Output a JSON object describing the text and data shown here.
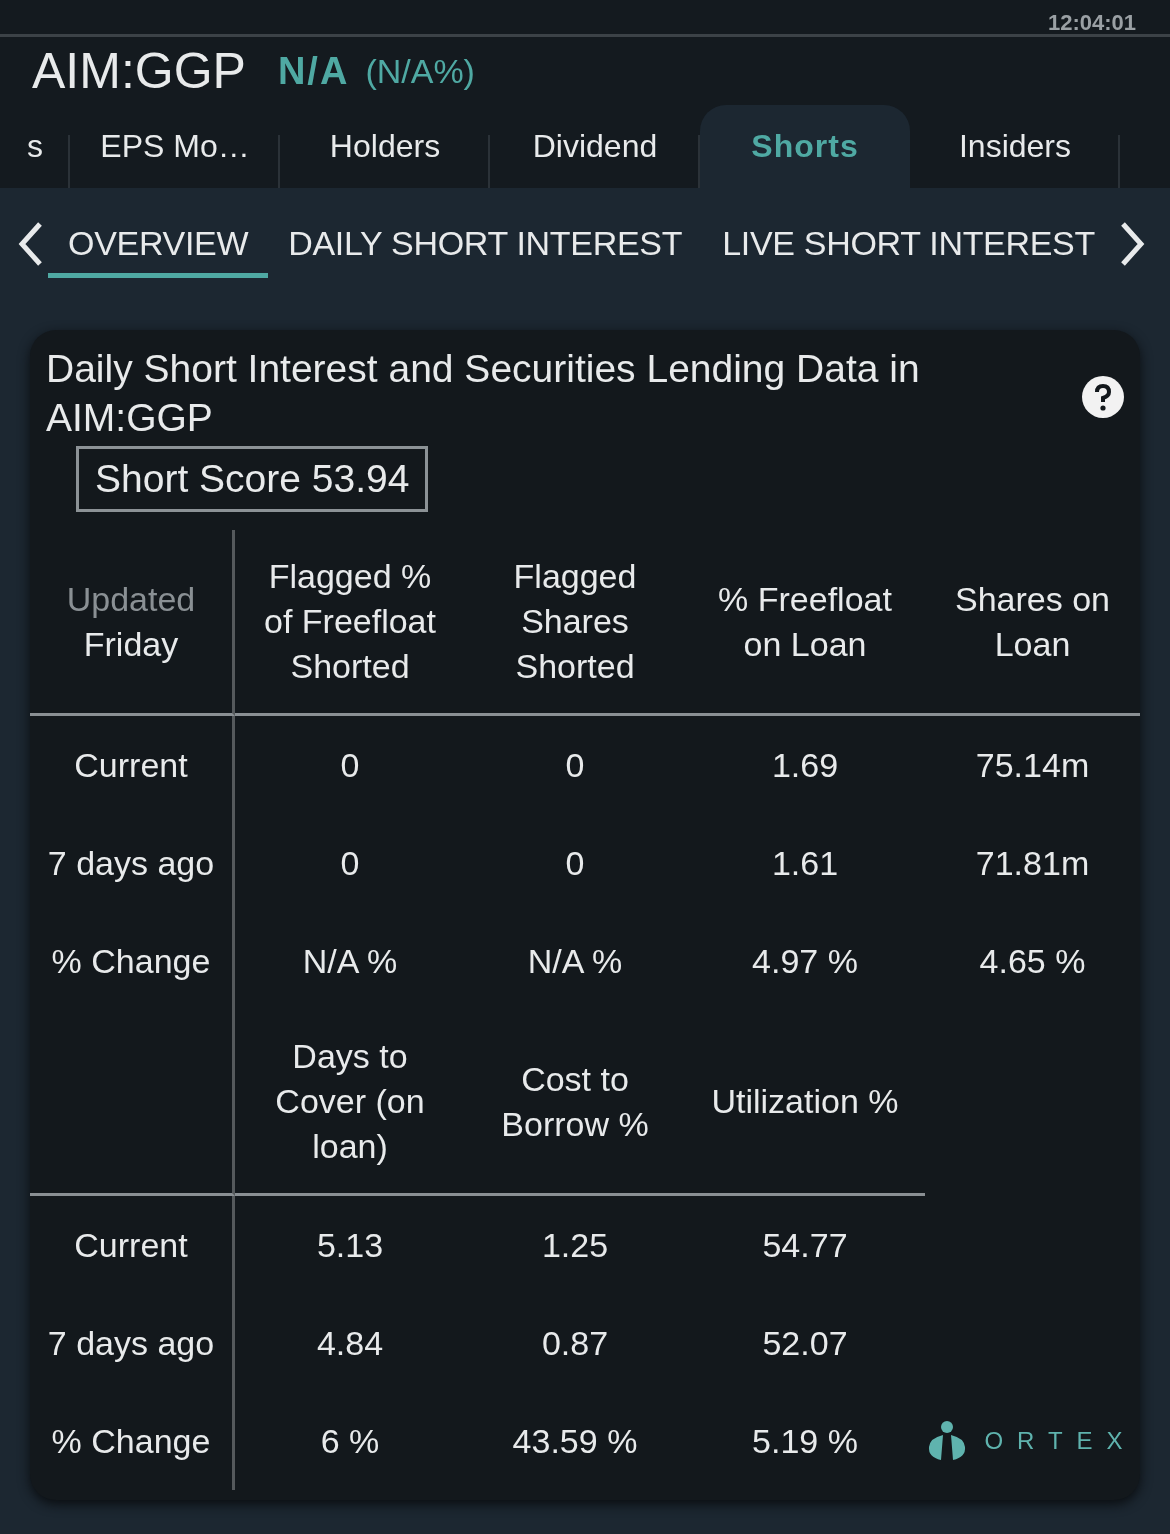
{
  "status_bar": {
    "time": "12:04:01"
  },
  "header": {
    "symbol": "AIM:GGP",
    "change": "N/A",
    "change_pct": "(N/A%)"
  },
  "tabs": [
    {
      "label": "s",
      "selected": false
    },
    {
      "label": "EPS Mo…",
      "selected": false
    },
    {
      "label": "Holders",
      "selected": false
    },
    {
      "label": "Dividend",
      "selected": false
    },
    {
      "label": "Shorts",
      "selected": true
    },
    {
      "label": "Insiders",
      "selected": false
    }
  ],
  "subtabs": [
    {
      "label": "OVERVIEW",
      "selected": true
    },
    {
      "label": "DAILY SHORT INTEREST",
      "selected": false
    },
    {
      "label": "LIVE SHORT INTEREST",
      "selected": false
    }
  ],
  "card": {
    "title": "Daily Short Interest and Securities Lending Data in AIM:GGP",
    "short_score": "Short Score 53.94",
    "sections": [
      {
        "corner": {
          "muted": "Updated",
          "text": "Friday"
        },
        "columns": [
          "Flagged % of Freefloat Shorted",
          "Flagged Shares Shorted",
          "% Freefloat on Loan",
          "Shares on Loan"
        ],
        "rows": [
          {
            "label": "Current",
            "cells": [
              "0",
              "0",
              "1.69",
              "75.14m"
            ]
          },
          {
            "label": "7 days ago",
            "cells": [
              "0",
              "0",
              "1.61",
              "71.81m"
            ]
          },
          {
            "label": "% Change",
            "cells": [
              "N/A %",
              "N/A %",
              "4.97 %",
              "4.65 %"
            ]
          }
        ]
      },
      {
        "columns": [
          "Days to Cover (on loan)",
          "Cost to Borrow %",
          "Utilization %"
        ],
        "rows": [
          {
            "label": "Current",
            "cells": [
              "5.13",
              "1.25",
              "54.77"
            ]
          },
          {
            "label": "7 days ago",
            "cells": [
              "4.84",
              "0.87",
              "52.07"
            ]
          },
          {
            "label": "% Change",
            "cells": [
              "6 %",
              "43.59 %",
              "5.19 %"
            ]
          }
        ]
      }
    ],
    "logo": "ORTEX"
  }
}
